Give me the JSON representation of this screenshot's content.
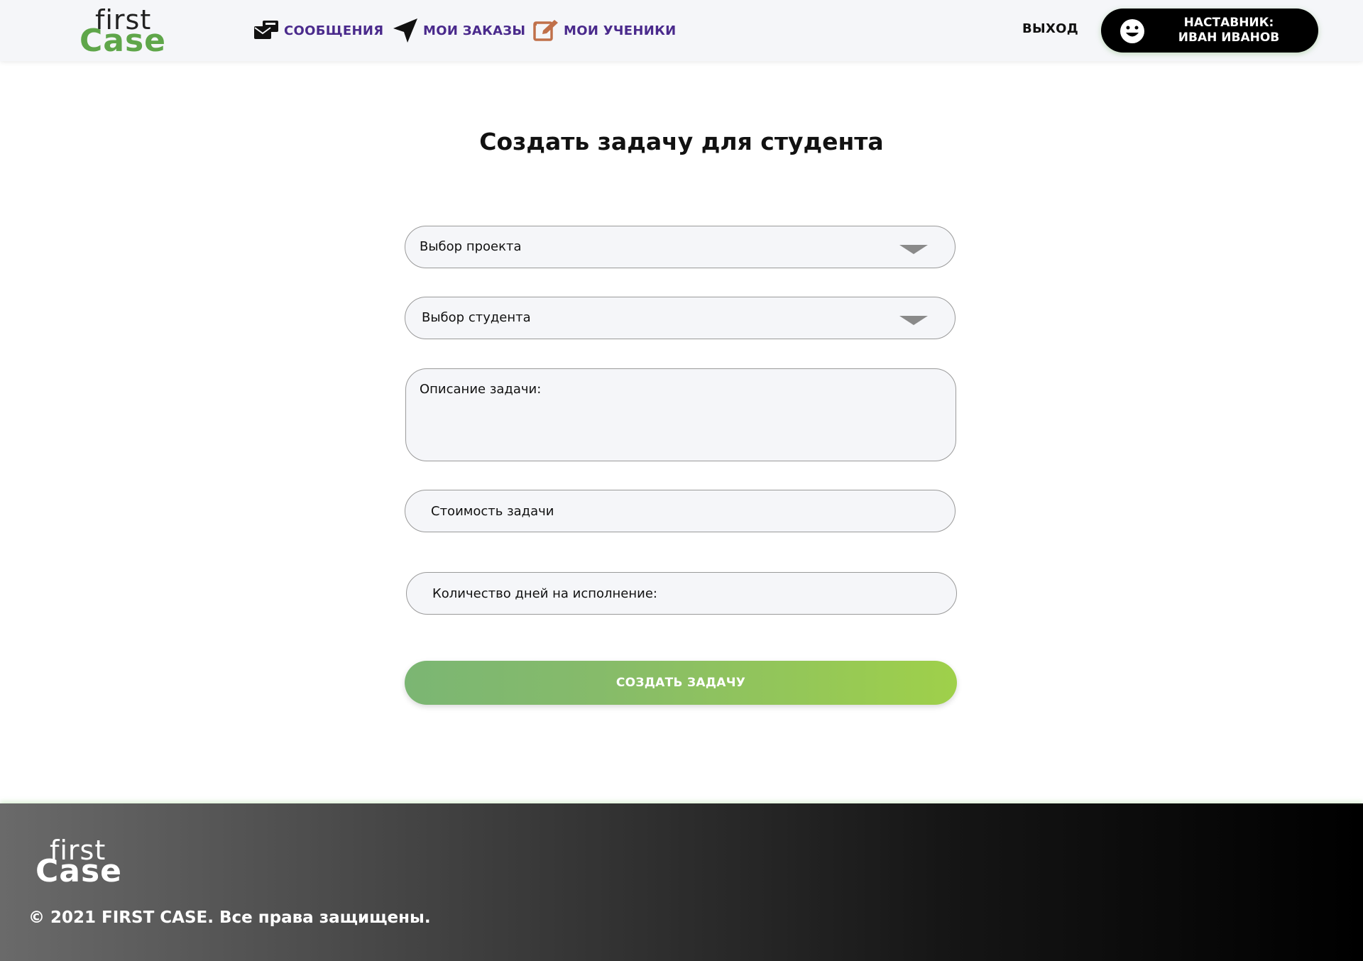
{
  "header": {
    "logo": {
      "first": "first",
      "case": "Case"
    },
    "nav": [
      {
        "label": "СООБЩЕНИЯ",
        "icon": "messages-icon"
      },
      {
        "label": "МОИ ЗАКАЗЫ",
        "icon": "paper-plane-icon"
      },
      {
        "label": "МОИ УЧЕНИКИ",
        "icon": "edit-icon"
      }
    ],
    "logout_label": "ВЫХОД",
    "profile": {
      "line1": "НАСТАВНИК:",
      "line2": "ИВАН ИВАНОВ",
      "icon": "smiley-icon"
    }
  },
  "main": {
    "title": "Создать задачу для студента",
    "project_select": {
      "value": "Выбор проекта"
    },
    "student_select": {
      "value": "Выбор студента"
    },
    "description": {
      "placeholder": "Описание задачи:"
    },
    "cost": {
      "placeholder": "Стоимость задачи"
    },
    "days": {
      "placeholder": "Количество дней на исполнение:"
    },
    "submit_label": "СОЗДАТЬ ЗАДАЧУ"
  },
  "footer": {
    "logo": {
      "first": "first",
      "case": "Case"
    },
    "copyright": "© 2021 FIRST CASE. Все права защищены."
  },
  "colors": {
    "nav_text": "#4a2a8c",
    "brand_green": "#5fa64a",
    "button_gradient_start": "#7bb673",
    "button_gradient_end": "#9fd04a",
    "edit_icon": "#c0704a"
  }
}
